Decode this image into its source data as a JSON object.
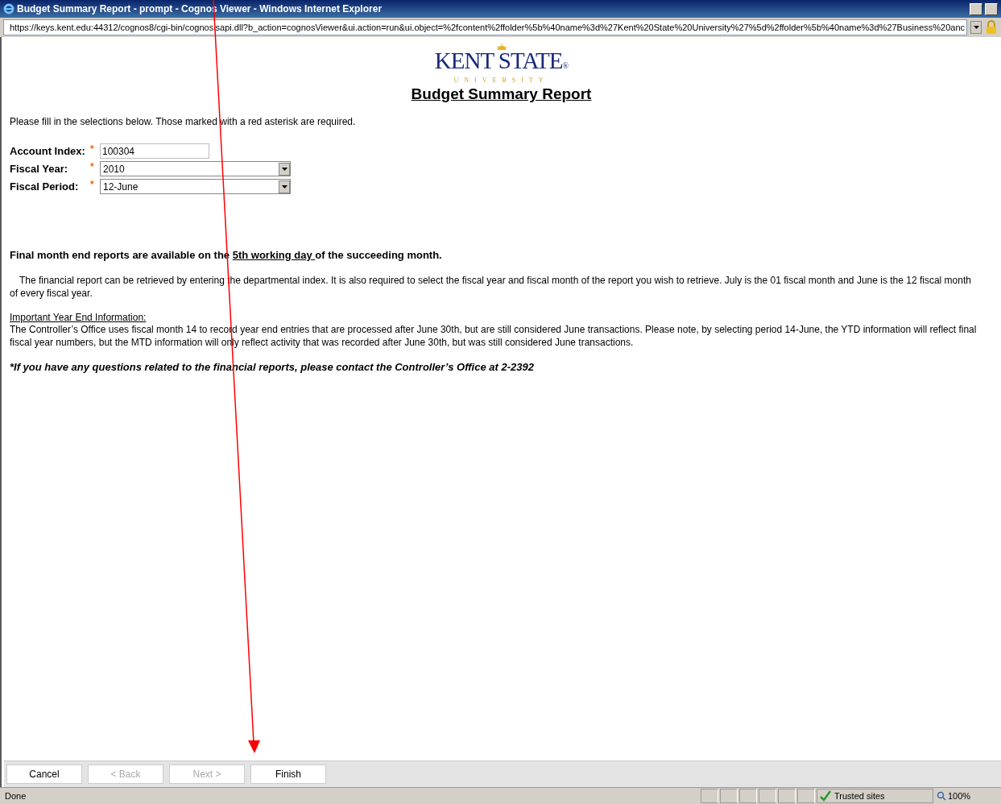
{
  "window": {
    "title": "Budget Summary Report - prompt - Cognos Viewer - Windows Internet Explorer"
  },
  "address_bar": {
    "url": "https://keys.kent.edu:44312/cognos8/cgi-bin/cognosisapi.dll?b_action=cognosViewer&ui.action=run&ui.object=%2fcontent%2ffolder%5b%40name%3d%27Kent%20State%20University%27%5d%2ffolder%5b%40name%3d%27Business%20anc"
  },
  "logo": {
    "name": "KENT STATE",
    "mark": "®",
    "sub": "UNIVERSITY"
  },
  "report_title": "Budget Summary Report",
  "instructions": "Please fill in the selections below.  Those marked with a red asterisk are required.",
  "fields": [
    {
      "kind": "text",
      "label": "Account Index:",
      "required_mark": "*",
      "value": "100304"
    },
    {
      "kind": "select",
      "label": "Fiscal Year:",
      "required_mark": "*",
      "value": "2010"
    },
    {
      "kind": "select",
      "label": "Fiscal Period:",
      "required_mark": "*",
      "value": "12-June"
    }
  ],
  "notice": {
    "before": "Final month end reports are available on the ",
    "link": "5th working day ",
    "after": "of the succeeding month."
  },
  "description": "The financial report can be retrieved by entering the departmental index.  It is also required to select the fiscal year and fiscal month of the report you wish to retrieve.  July is the 01 fiscal month and June is the 12 fiscal month of every fiscal year.",
  "year_end": {
    "heading": "Important Year End Information:",
    "text": "The Controller’s Office uses fiscal month 14 to record year end entries that are processed after June 30th, but are still considered June transactions.  Please note, by selecting period 14-June, the YTD information will reflect final fiscal year numbers, but the MTD information will only reflect activity that was recorded after June 30th, but was still considered June transactions."
  },
  "contact": "*If you have any questions related to the financial reports, please contact the Controller’s Office at 2-2392",
  "buttons": [
    {
      "label": "Cancel",
      "disabled": false
    },
    {
      "label": "< Back",
      "disabled": true
    },
    {
      "label": "Next >",
      "disabled": true
    },
    {
      "label": "Finish",
      "disabled": false
    }
  ],
  "status_bar": {
    "text": "Done",
    "zone": "Trusted sites",
    "zoom": "100%"
  }
}
